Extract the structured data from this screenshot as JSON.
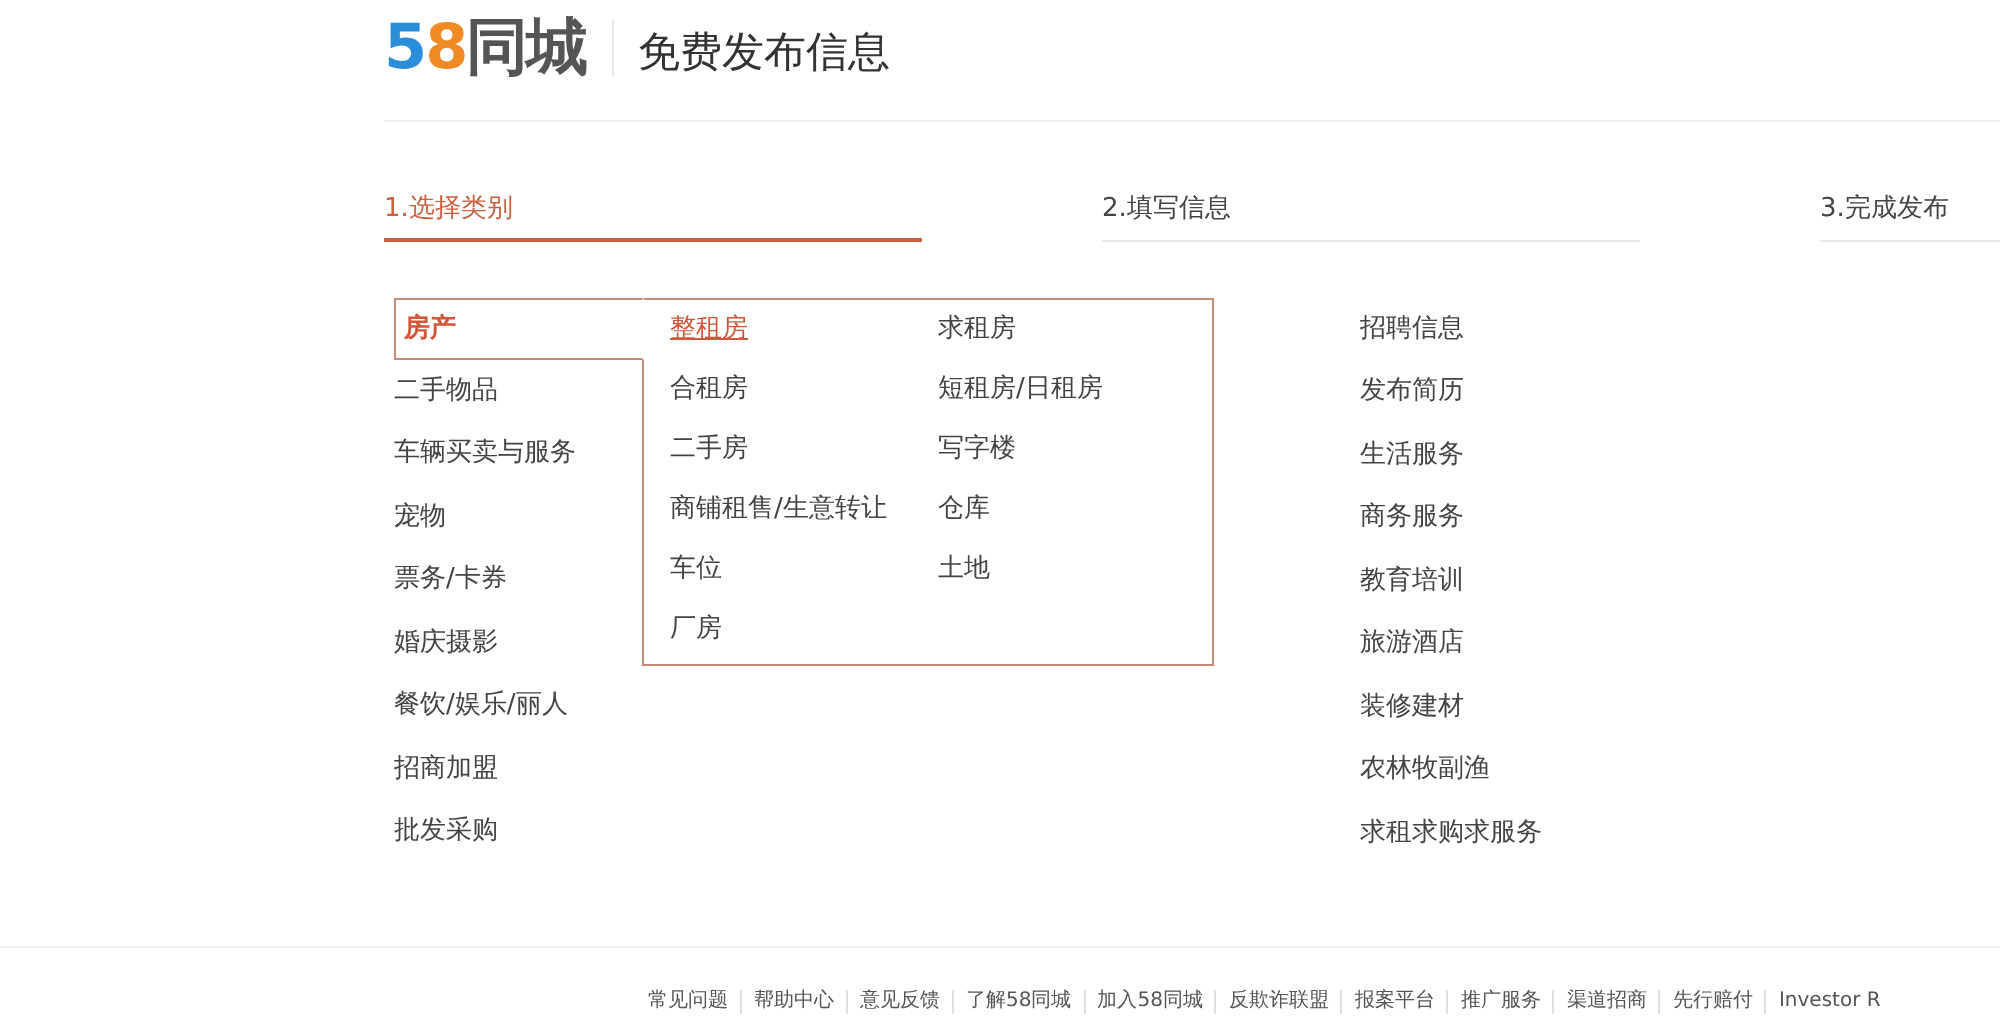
{
  "header": {
    "logo_digits": "58",
    "logo_name": "同城",
    "title": "免费发布信息"
  },
  "steps": [
    {
      "label": "1.选择类别",
      "selected": true
    },
    {
      "label": "2.填写信息",
      "selected": false
    },
    {
      "label": "3.完成发布",
      "selected": false
    }
  ],
  "categories": [
    {
      "label": "房产",
      "selected": true
    },
    {
      "label": "二手物品",
      "selected": false
    },
    {
      "label": "车辆买卖与服务",
      "selected": false
    },
    {
      "label": "宠物",
      "selected": false
    },
    {
      "label": "票务/卡券",
      "selected": false
    },
    {
      "label": "婚庆摄影",
      "selected": false
    },
    {
      "label": "餐饮/娱乐/丽人",
      "selected": false
    },
    {
      "label": "招商加盟",
      "selected": false
    },
    {
      "label": "批发采购",
      "selected": false
    }
  ],
  "subcategories": [
    {
      "label": "整租房",
      "selected": true
    },
    {
      "label": "求租房",
      "selected": false
    },
    {
      "label": "合租房",
      "selected": false
    },
    {
      "label": "短租房/日租房",
      "selected": false
    },
    {
      "label": "二手房",
      "selected": false
    },
    {
      "label": "写字楼",
      "selected": false
    },
    {
      "label": "商铺租售/生意转让",
      "selected": false
    },
    {
      "label": "仓库",
      "selected": false
    },
    {
      "label": "车位",
      "selected": false
    },
    {
      "label": "土地",
      "selected": false
    },
    {
      "label": "厂房",
      "selected": false
    }
  ],
  "more_categories": [
    {
      "label": "招聘信息"
    },
    {
      "label": "发布简历"
    },
    {
      "label": "生活服务"
    },
    {
      "label": "商务服务"
    },
    {
      "label": "教育培训"
    },
    {
      "label": "旅游酒店"
    },
    {
      "label": "装修建材"
    },
    {
      "label": "农林牧副渔"
    },
    {
      "label": "求租求购求服务"
    }
  ],
  "footer_links": [
    "常见问题",
    "帮助中心",
    "意见反馈",
    "了解58同城",
    "加入58同城",
    "反欺诈联盟",
    "报案平台",
    "推广服务",
    "渠道招商",
    "先行赔付",
    "Investor R"
  ]
}
